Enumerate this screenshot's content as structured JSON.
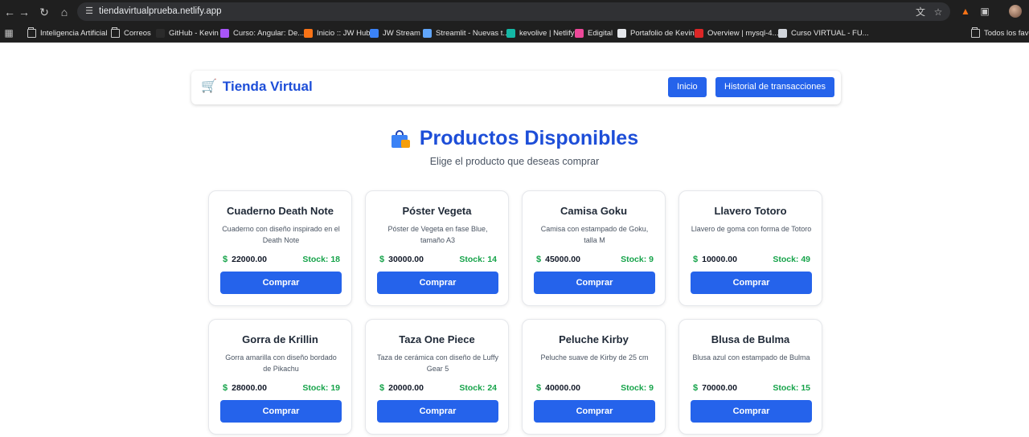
{
  "browser": {
    "url": "tiendavirtualprueba.netlify.app",
    "bookmarks": [
      {
        "label": "Inteligencia Artificial",
        "icon": "folder-icon",
        "color": "#c7c7c7"
      },
      {
        "label": "Correos",
        "icon": "folder-icon",
        "color": "#c7c7c7"
      },
      {
        "label": "GitHub - Kevin",
        "icon": "github-icon",
        "color": "#2b2b2b"
      },
      {
        "label": "Curso: Angular: De...",
        "icon": "course-icon",
        "color": "#a855f7"
      },
      {
        "label": "Inicio :: JW Hub",
        "icon": "jw-icon",
        "color": "#f97316"
      },
      {
        "label": "JW Stream",
        "icon": "jw-stream-icon",
        "color": "#3b82f6"
      },
      {
        "label": "Streamlit - Nuevas t...",
        "icon": "streamlit-icon",
        "color": "#60a5fa"
      },
      {
        "label": "kevolive | Netlify",
        "icon": "netlify-icon",
        "color": "#14b8a6"
      },
      {
        "label": "Edigital",
        "icon": "edigital-icon",
        "color": "#ec4899"
      },
      {
        "label": "Portafolio de Kevin",
        "icon": "portfolio-icon",
        "color": "#e5e7eb"
      },
      {
        "label": "Overview | mysql-4...",
        "icon": "mysql-icon",
        "color": "#dc2626"
      },
      {
        "label": "Curso VIRTUAL - FU...",
        "icon": "virtual-course-icon",
        "color": "#d1d5db"
      },
      {
        "label": "Todos los favor",
        "icon": "folder-icon",
        "color": "#c7c7c7"
      }
    ]
  },
  "app": {
    "brand": "Tienda Virtual",
    "nav": {
      "home": "Inicio",
      "history": "Historial de transacciones"
    },
    "title": "Productos Disponibles",
    "subtitle": "Elige el producto que deseas comprar",
    "buy_label": "Comprar",
    "accent": "#2563eb",
    "stock_color": "#16a34a"
  },
  "products": [
    {
      "name": "Cuaderno Death Note",
      "description": "Cuaderno con diseño inspirado en el Death Note",
      "price": "22000.00",
      "stock": "Stock: 18"
    },
    {
      "name": "Póster Vegeta",
      "description": "Póster de Vegeta en fase Blue, tamaño A3",
      "price": "30000.00",
      "stock": "Stock: 14"
    },
    {
      "name": "Camisa Goku",
      "description": "Camisa con estampado de Goku, talla M",
      "price": "45000.00",
      "stock": "Stock: 9"
    },
    {
      "name": "Llavero Totoro",
      "description": "Llavero de goma con forma de Totoro",
      "price": "10000.00",
      "stock": "Stock: 49"
    },
    {
      "name": "Gorra de Krillin",
      "description": "Gorra amarilla con diseño bordado de Pikachu",
      "price": "28000.00",
      "stock": "Stock: 19"
    },
    {
      "name": "Taza One Piece",
      "description": "Taza de cerámica con diseño de Luffy Gear 5",
      "price": "20000.00",
      "stock": "Stock: 24"
    },
    {
      "name": "Peluche Kirby",
      "description": "Peluche suave de Kirby de 25 cm",
      "price": "40000.00",
      "stock": "Stock: 9"
    },
    {
      "name": "Blusa de Bulma",
      "description": "Blusa azul con estampado de Bulma",
      "price": "70000.00",
      "stock": "Stock: 15"
    }
  ]
}
